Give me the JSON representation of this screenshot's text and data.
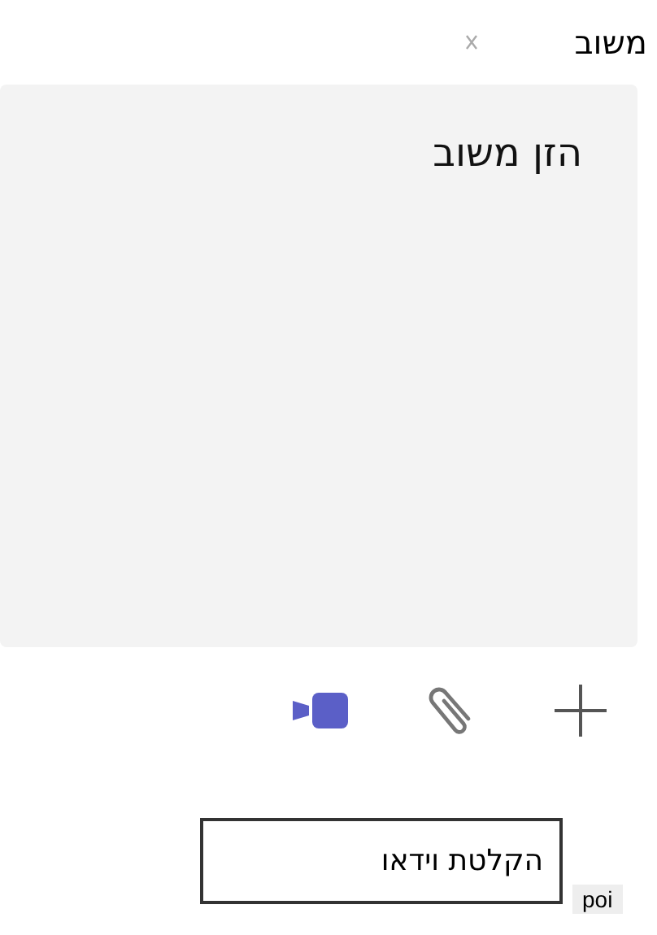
{
  "title": "משוב",
  "feedback": {
    "placeholder": "הזן משוב"
  },
  "toolbar": [
    {
      "kind": "plus"
    },
    {
      "kind": "attach"
    },
    {
      "kind": "video"
    }
  ],
  "tooltip": "הקלטת וידאו",
  "badge": "poi"
}
